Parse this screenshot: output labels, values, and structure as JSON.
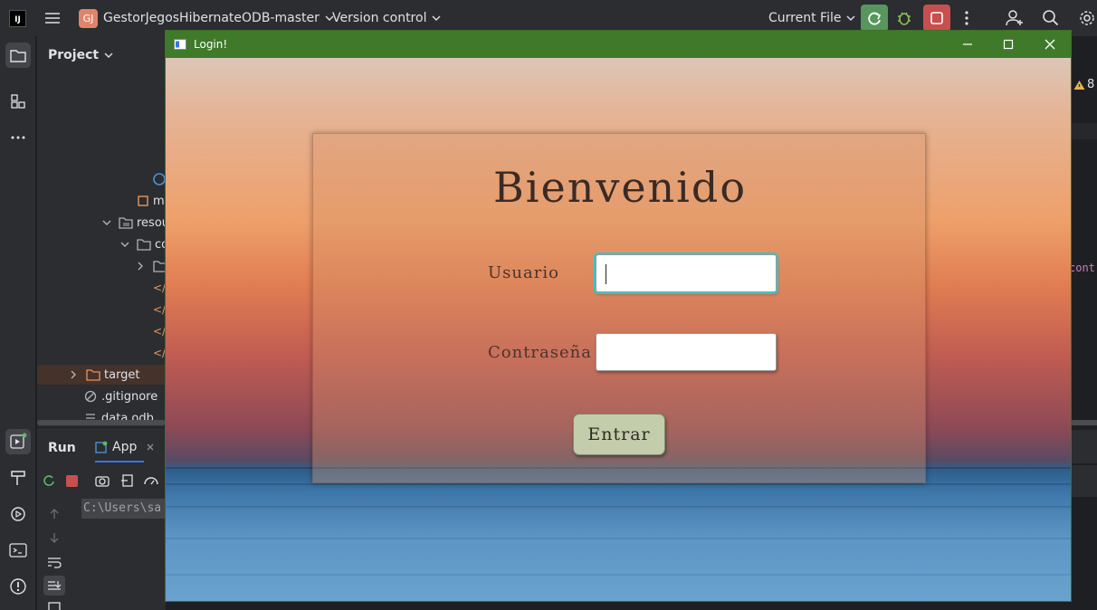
{
  "ide": {
    "logo_text": "IJ",
    "project_badge": "GJ",
    "project_name": "GestorJegosHibernateODB-master",
    "vcs_label": "Version control",
    "run_config": "Current File"
  },
  "project_panel": {
    "title": "Project",
    "rows": {
      "mo": "mo",
      "resources": "resou",
      "co": "co",
      "target": "target",
      "gitignore": ".gitignore",
      "data": "data.odb"
    }
  },
  "run_panel": {
    "run_tab": "Run",
    "app_tab": "App",
    "console_text": "C:\\Users\\sa"
  },
  "editor_fragments": {
    "warning_count": "8",
    "cont_text": "cont"
  },
  "login": {
    "window_title": "Login!",
    "heading": "Bienvenido",
    "user_label": "Usuario",
    "password_label": "Contraseña",
    "user_value": "",
    "password_value": "",
    "enter_button": "Entrar"
  },
  "colors": {
    "ide_bg": "#2b2d30",
    "login_titlebar": "#3f7a2a",
    "input_focus": "#37c5c8",
    "button_bg": "#c3ccab"
  }
}
